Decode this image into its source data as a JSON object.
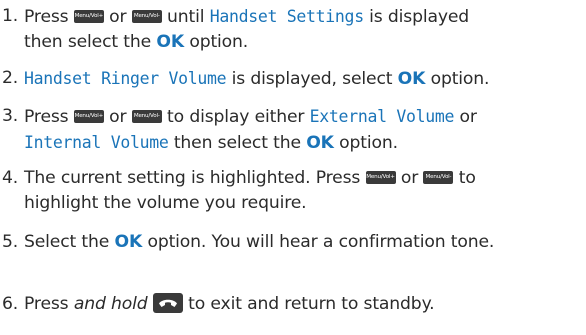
{
  "steps": [
    {
      "number": "1.",
      "lines": [
        {
          "t1": "Press ",
          "k1": "Menu/Vol+",
          "t2": " or ",
          "k2": "Menu/Vol-",
          "t3": " until ",
          "lcd": "Handset Settings",
          "t4": " is displayed"
        },
        {
          "t1": "then select the ",
          "ok": "OK",
          "t2": " option."
        }
      ]
    },
    {
      "number": "2.",
      "lines": [
        {
          "lcd": "Handset Ringer Volume",
          "t1": " is displayed, select ",
          "ok": "OK",
          "t2": " option."
        }
      ]
    },
    {
      "number": "3.",
      "lines": [
        {
          "t1": "Press ",
          "k1": "Menu/Vol+",
          "t2": " or ",
          "k2": "Menu/Vol-",
          "t3": " to display either ",
          "lcd": "External Volume",
          "t4": " or"
        },
        {
          "lcd": "Internal Volume",
          "t1": " then select the ",
          "ok": "OK",
          "t2": " option."
        }
      ]
    },
    {
      "number": "4.",
      "lines": [
        {
          "t1": "The current setting is highlighted. Press ",
          "k1": "Menu/Vol+",
          "t2": " or ",
          "k2": "Menu/Vol-",
          "t3": " to"
        },
        {
          "t1": "highlight the volume you require."
        }
      ]
    },
    {
      "number": "5.",
      "lines": [
        {
          "t1": "Select the ",
          "ok": "OK",
          "t2": " option. You will hear a confirmation tone."
        }
      ]
    },
    {
      "number": "6.",
      "lines": [
        {
          "t1": "Press ",
          "em": "and hold",
          "t2": " to exit and return to standby."
        }
      ]
    }
  ],
  "colors": {
    "text": "#2b2b2b",
    "accent": "#1a74b8",
    "key_bg": "#3a3a3a"
  },
  "icons": {
    "menu_key": "menu-vol-key-icon",
    "end_key": "end-call-key-icon"
  }
}
